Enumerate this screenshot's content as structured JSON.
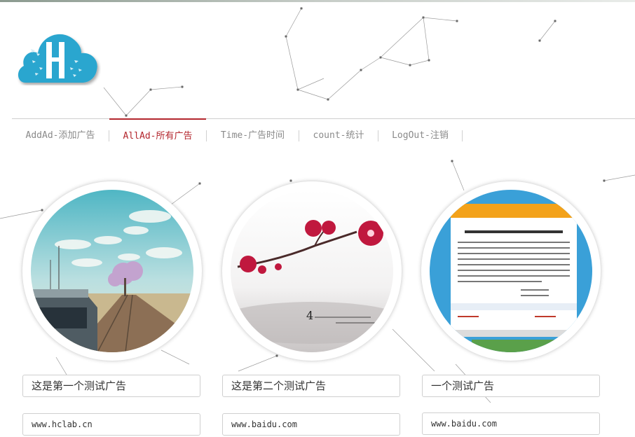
{
  "header": {
    "logo": {
      "letter": "H",
      "icon": "cloud-h-logo"
    }
  },
  "nav": {
    "items": [
      {
        "label": "AddAd-添加广告",
        "active": false
      },
      {
        "label": "AllAd-所有广告",
        "active": true
      },
      {
        "label": "Time-广告时间",
        "active": false
      },
      {
        "label": "count-统计",
        "active": false
      },
      {
        "label": "LogOut-注销",
        "active": false
      }
    ]
  },
  "ads": [
    {
      "image": "anime-railway-tree-landscape",
      "title": "这是第一个测试广告",
      "url": "www.hclab.cn"
    },
    {
      "image": "plum-blossom-branch",
      "title": "这是第二个测试广告",
      "url": "www.baidu.com",
      "image_text": "4"
    },
    {
      "image": "document-notice-webpage",
      "title": "一个测试广告",
      "url": "www.baidu.com"
    }
  ],
  "colors": {
    "accent": "#b3262d",
    "logo_blue": "#2aa6cf",
    "nav_text": "#8a8a8a"
  }
}
